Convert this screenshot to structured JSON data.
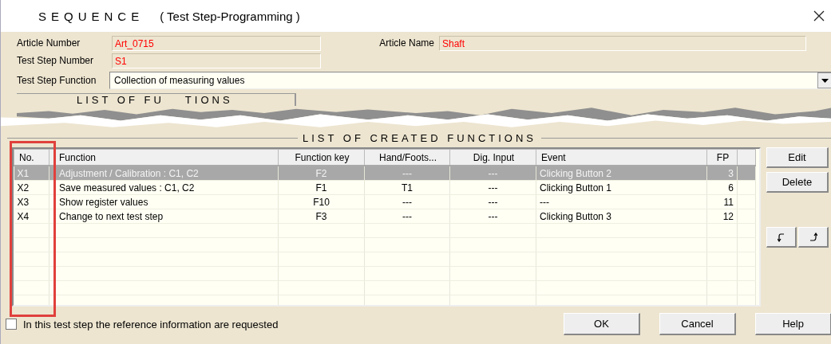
{
  "window": {
    "title": "SEQUENCE",
    "subtitle": "( Test Step-Programming )"
  },
  "header_fields": [
    {
      "label": "Article Number",
      "value": "Art_0715"
    },
    {
      "label": "Article Name",
      "value": "Shaft"
    },
    {
      "label": "Test Step Number",
      "value": "S1"
    }
  ],
  "test_step_function": {
    "label": "Test Step Function",
    "value": "Collection of measuring values"
  },
  "collapsed_section": {
    "label_parts": [
      "LIST OF FU",
      "TIONS"
    ]
  },
  "created_functions": {
    "title": "LIST OF CREATED FUNCTIONS",
    "columns": [
      "No.",
      "Function",
      "Function key",
      "Hand/Foots...",
      "Dig. Input",
      "Event",
      "FP"
    ],
    "rows": [
      {
        "cells": [
          "X1",
          "Adjustment / Calibration :  C1, C2",
          "F2",
          "---",
          "---",
          "Clicking Button 2",
          "3"
        ],
        "selected": true
      },
      {
        "cells": [
          "X2",
          "Save measured values :  C1, C2",
          "F1",
          "T1",
          "---",
          "Clicking Button 1",
          "6"
        ],
        "selected": false
      },
      {
        "cells": [
          "X3",
          "Show register values",
          "F10",
          "---",
          "---",
          "---",
          "11"
        ],
        "selected": false
      },
      {
        "cells": [
          "X4",
          "Change to next test step",
          "F3",
          "---",
          "---",
          "Clicking Button 3",
          "12"
        ],
        "selected": false
      }
    ]
  },
  "side_buttons": [
    "Edit",
    "Delete"
  ],
  "reference_check": {
    "label": "In this test step the reference information are requested",
    "checked": false
  },
  "buttons": [
    "OK",
    "Cancel",
    "Help"
  ]
}
